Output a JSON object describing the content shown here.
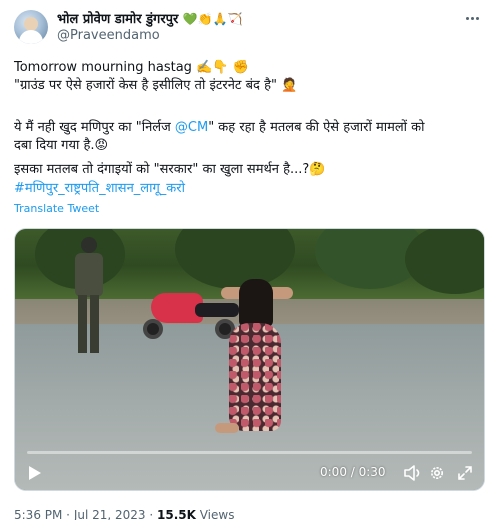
{
  "author": {
    "display_name": "भोल प्रोवेण डामोर डुंगरपुर",
    "name_emojis": "💚👏🙏🏹",
    "handle": "@Praveendamo"
  },
  "tweet": {
    "line1": "Tomorrow mourning hastag ✍️👇 ✊",
    "line2": "\"ग्राउंड पर ऐसे हजारों केस है इसीलिए तो इंटरनेट बंद है\" 🤦",
    "line3_pre": "ये मैं नही खुद मणिपुर का \"निर्लज ",
    "line3_mention": "@CM",
    "line3_post": "\" कह रहा है मतलब की ऐसे हजारों मामलों को",
    "line4": "दबा दिया गया है.😡",
    "line5": "इसका मतलब तो दंगाइयों को \"सरकार\" का खुला समर्थन है...?🤔",
    "hashtag": "#मणिपुर_राष्ट्रपति_शासन_लागू_करो",
    "translate_label": "Translate Tweet"
  },
  "video": {
    "time_display": "0:00 / 0:30",
    "progress": 0,
    "icons": {
      "play": "play-icon",
      "volume": "volume-icon",
      "settings": "gear-icon",
      "fullscreen": "fullscreen-icon"
    }
  },
  "meta": {
    "time": "5:36 PM",
    "separator": " · ",
    "date": "Jul 21, 2023",
    "views_count": "15.5K",
    "views_label": " Views"
  },
  "colors": {
    "link": "#1d9bf0",
    "secondary_text": "#536471",
    "primary_text": "#0f1419"
  }
}
